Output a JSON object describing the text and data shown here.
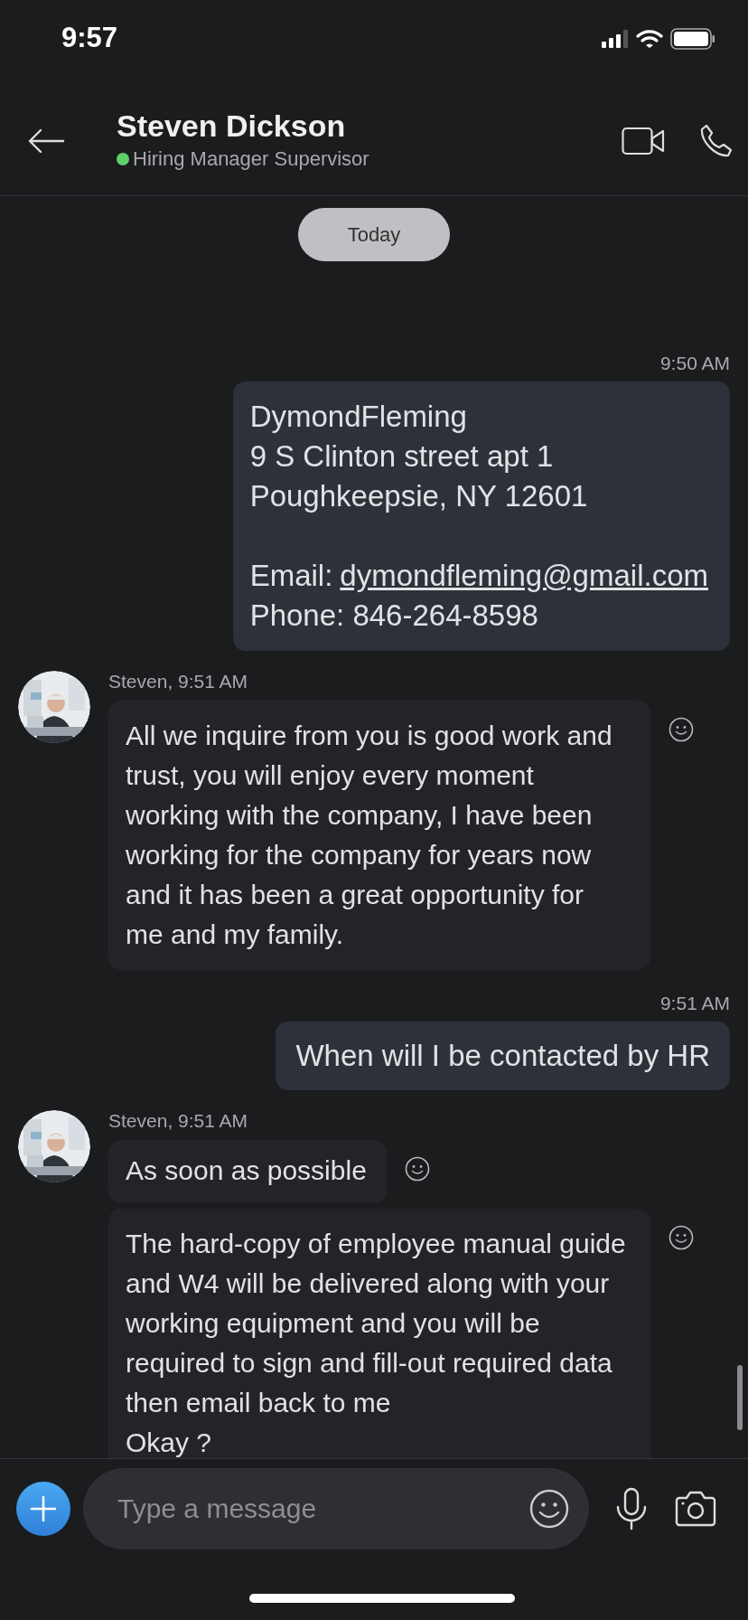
{
  "status_bar": {
    "time": "9:57"
  },
  "header": {
    "name": "Steven Dickson",
    "online": true,
    "subtitle": "Hiring Manager Supervisor"
  },
  "date_divider": "Today",
  "messages": [
    {
      "kind": "sent",
      "time": "9:50 AM",
      "contact": {
        "address": [
          "DymondFleming",
          "9 S Clinton street apt 1",
          "Poughkeepsie, NY 12601"
        ],
        "email_label": "Email:",
        "email": "dymondfleming@gmail.com",
        "phone": "Phone: 846-264-8598"
      }
    },
    {
      "kind": "received",
      "sender_label": "Steven, 9:51 AM",
      "bubbles": [
        {
          "text": "All we inquire from you is good work and trust, you will enjoy every moment working with the company, I have been working for the company for years now  and it has been a great opportunity for me and my family."
        }
      ]
    },
    {
      "kind": "sent",
      "time": "9:51 AM",
      "text": "When will I be contacted by HR"
    },
    {
      "kind": "received",
      "sender_label": "Steven, 9:51 AM",
      "bubbles": [
        {
          "text": "As soon as possible"
        },
        {
          "text": "The hard-copy of employee manual guide and W4 will be delivered along with your working equipment and you will be required to sign and fill-out required data then email back to me\nOkay ?"
        }
      ]
    }
  ],
  "composer": {
    "placeholder": "Type a message"
  }
}
